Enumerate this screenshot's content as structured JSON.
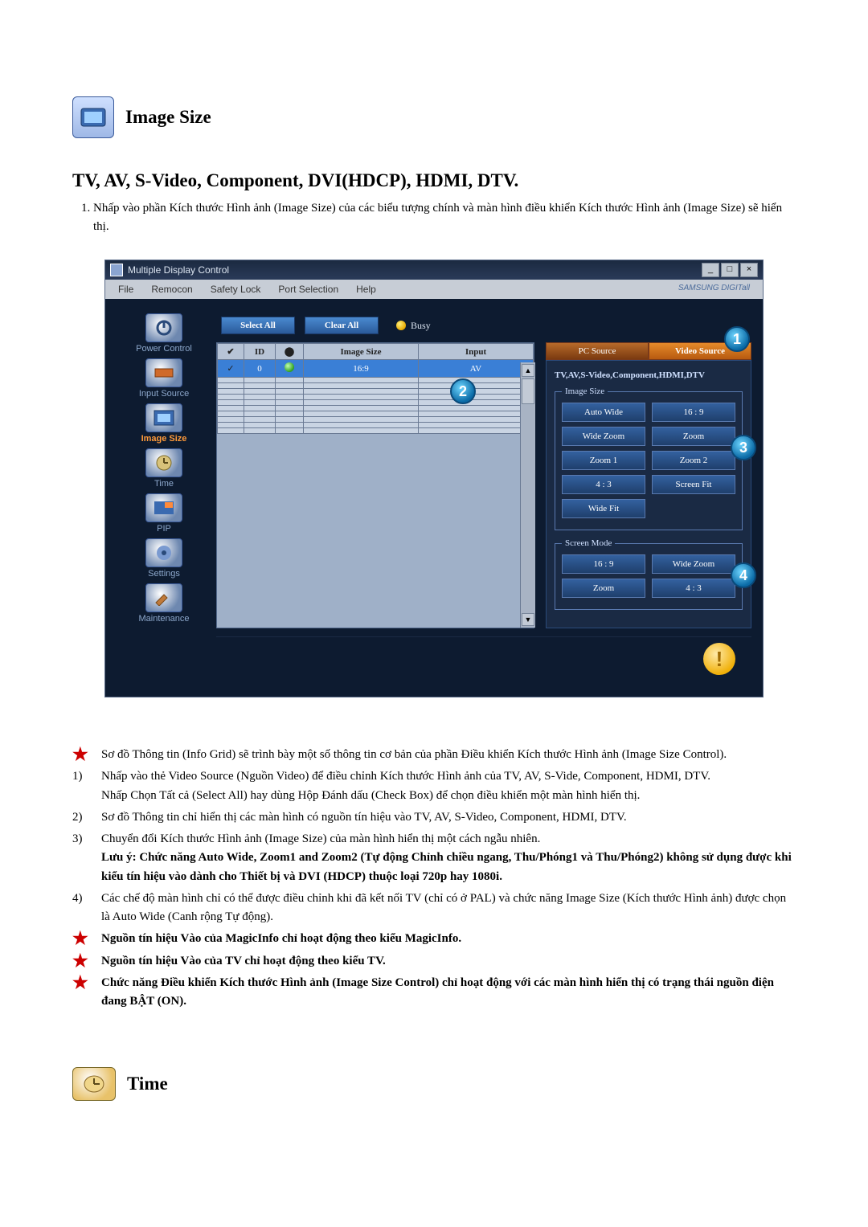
{
  "section1": {
    "icon": "image-size-icon",
    "title": "Image Size",
    "subtitle": "TV, AV, S-Video, Component, DVI(HDCP), HDMI, DTV.",
    "intro_1": "Nhấp vào phần Kích thước Hình ảnh (Image Size) của các biểu tượng chính và màn hình điều khiển Kích thước Hình ảnh (Image Size) sẽ hiển thị."
  },
  "window": {
    "title": "Multiple Display Control",
    "min": "_",
    "max": "□",
    "close": "×",
    "brand": "SAMSUNG DIGITall",
    "menu": [
      "File",
      "Remocon",
      "Safety Lock",
      "Port Selection",
      "Help"
    ],
    "sidebar": [
      {
        "label": "Power Control",
        "icon": "power-icon"
      },
      {
        "label": "Input Source",
        "icon": "input-icon"
      },
      {
        "label": "Image Size",
        "icon": "image-size-icon",
        "active": true
      },
      {
        "label": "Time",
        "icon": "time-icon"
      },
      {
        "label": "PIP",
        "icon": "pip-icon"
      },
      {
        "label": "Settings",
        "icon": "settings-icon"
      },
      {
        "label": "Maintenance",
        "icon": "maintenance-icon"
      }
    ],
    "topbar": {
      "select_all": "Select All",
      "clear_all": "Clear All",
      "busy": "Busy"
    },
    "grid": {
      "headers": {
        "chk": "",
        "id": "ID",
        "st": "",
        "size": "Image Size",
        "input": "Input"
      },
      "rows": [
        {
          "on": true,
          "sel": true,
          "id": "0",
          "size": "16:9",
          "input": "AV"
        },
        {
          "on": false,
          "sel": false,
          "id": "",
          "size": "",
          "input": ""
        },
        {
          "on": false,
          "sel": false,
          "id": "",
          "size": "",
          "input": ""
        },
        {
          "on": false,
          "sel": false,
          "id": "",
          "size": "",
          "input": ""
        },
        {
          "on": false,
          "sel": false,
          "id": "",
          "size": "",
          "input": ""
        },
        {
          "on": false,
          "sel": false,
          "id": "",
          "size": "",
          "input": ""
        },
        {
          "on": false,
          "sel": false,
          "id": "",
          "size": "",
          "input": ""
        },
        {
          "on": false,
          "sel": false,
          "id": "",
          "size": "",
          "input": ""
        },
        {
          "on": false,
          "sel": false,
          "id": "",
          "size": "",
          "input": ""
        },
        {
          "on": false,
          "sel": false,
          "id": "",
          "size": "",
          "input": ""
        },
        {
          "on": false,
          "sel": false,
          "id": "",
          "size": "",
          "input": ""
        }
      ]
    },
    "rpanel": {
      "tab_pc": "PC Source",
      "tab_video": "Video Source",
      "line": "TV,AV,S-Video,Component,HDMI,DTV",
      "fs1": {
        "legend": "Image Size",
        "buttons": [
          "Auto Wide",
          "16 : 9",
          "Wide Zoom",
          "Zoom",
          "Zoom 1",
          "Zoom 2",
          "4 : 3",
          "Screen Fit",
          "Wide Fit"
        ]
      },
      "fs2": {
        "legend": "Screen Mode",
        "buttons": [
          "16 : 9",
          "Wide Zoom",
          "Zoom",
          "4 : 3"
        ]
      }
    },
    "status_icon": "!"
  },
  "callouts": {
    "c1": "1",
    "c2": "2",
    "c3": "3",
    "c4": "4"
  },
  "notes": {
    "n0": "Sơ đồ Thông tin (Info Grid) sẽ trình bày một số thông tin cơ bản của phần Điều khiển Kích thước Hình ảnh (Image Size Control).",
    "n1a": "Nhấp vào thẻ Video Source (Nguồn Video) để điều chỉnh Kích thước Hình ảnh của TV, AV, S-Vide, Component, HDMI, DTV.",
    "n1b": "Nhấp Chọn Tất cả (Select All) hay dùng Hộp Đánh dấu (Check Box) để chọn điều khiển một màn hình hiển thị.",
    "n2": "Sơ đồ Thông tin chỉ hiển thị các màn hình có nguồn tín hiệu vào TV, AV, S-Video, Component, HDMI, DTV.",
    "n3a": "Chuyển đổi Kích thước Hình ảnh (Image Size) của màn hình hiển thị một cách ngẫu nhiên.",
    "n3b_bold": "Lưu ý: Chức năng Auto Wide, Zoom1 and Zoom2 (Tự động Chỉnh chiều ngang, Thu/Phóng1 và Thu/Phóng2) không sử dụng được khi kiểu tín hiệu vào dành cho Thiết bị và DVI (HDCP) thuộc loại 720p hay 1080i.",
    "n4": "Các chế độ màn hình chỉ có thể được điều chỉnh khi đã kết nối TV (chỉ có ở PAL) và chức năng Image Size (Kích thước Hình ảnh) được chọn là Auto Wide (Canh rộng Tự động).",
    "n5_bold": "Nguồn tín hiệu Vào của MagicInfo chỉ hoạt động theo kiểu MagicInfo.",
    "n6_bold": "Nguồn tín hiệu Vào của TV chỉ hoạt động theo kiểu TV.",
    "n7_bold": "Chức năng Điều khiển Kích thước Hình ảnh (Image Size Control) chỉ hoạt động với các màn hình hiển thị có trạng thái nguồn điện đang BẬT (ON)."
  },
  "section2": {
    "title": "Time"
  }
}
